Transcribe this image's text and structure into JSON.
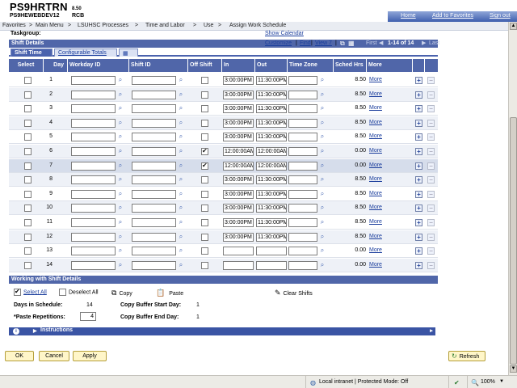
{
  "app": {
    "title": "PS9HRTRN",
    "version": "8.50",
    "database": "PS9HEWEBDEV12",
    "user": "RCB",
    "top_links": [
      "Home",
      "Add to Favorites",
      "Sign out"
    ]
  },
  "nav": {
    "breadcrumb": [
      "Favorites",
      "Main Menu",
      "LSUHSC Processes",
      "Time and Labor",
      "Use",
      "Assign Work Schedule"
    ],
    "separator": ">"
  },
  "taskgroup_label": "Taskgroup:",
  "show_calendar_link": "Show Calendar",
  "shift_details": {
    "title": "Shift Details",
    "tabs": [
      "Shift Time",
      "Configurable Totals"
    ],
    "pager": {
      "customize": "Customize",
      "find": "Find",
      "view": "View 7",
      "first": "First",
      "range": "1-14 of 14",
      "last": "Last"
    },
    "columns": [
      "Select",
      "Day",
      "Workday ID",
      "Shift ID",
      "Off Shift",
      "In",
      "Out",
      "Time Zone",
      "Sched Hrs",
      "More"
    ],
    "more_label": "More",
    "rows": [
      {
        "day": "1",
        "off": false,
        "in": "3:00:00PM",
        "out": "11:30:00PM",
        "hrs": "8.50"
      },
      {
        "day": "2",
        "off": false,
        "in": "3:00:00PM",
        "out": "11:30:00PM",
        "hrs": "8.50"
      },
      {
        "day": "3",
        "off": false,
        "in": "3:00:00PM",
        "out": "11:30:00PM",
        "hrs": "8.50"
      },
      {
        "day": "4",
        "off": false,
        "in": "3:00:00PM",
        "out": "11:30:00PM",
        "hrs": "8.50"
      },
      {
        "day": "5",
        "off": false,
        "in": "3:00:00PM",
        "out": "11:30:00PM",
        "hrs": "8.50"
      },
      {
        "day": "6",
        "off": true,
        "in": "12:00:00AM",
        "out": "12:00:00AM",
        "hrs": "0.00"
      },
      {
        "day": "7",
        "off": true,
        "in": "12:00:00AM",
        "out": "12:00:00AM",
        "hrs": "0.00"
      },
      {
        "day": "8",
        "off": false,
        "in": "3:00:00PM",
        "out": "11:30:00PM",
        "hrs": "8.50"
      },
      {
        "day": "9",
        "off": false,
        "in": "3:00:00PM",
        "out": "11:30:00PM",
        "hrs": "8.50"
      },
      {
        "day": "10",
        "off": false,
        "in": "3:00:00PM",
        "out": "11:30:00PM",
        "hrs": "8.50"
      },
      {
        "day": "11",
        "off": false,
        "in": "3:00:00PM",
        "out": "11:30:00PM",
        "hrs": "8.50"
      },
      {
        "day": "12",
        "off": false,
        "in": "3:00:00PM",
        "out": "11:30:00PM",
        "hrs": "8.50"
      },
      {
        "day": "13",
        "off": false,
        "in": "",
        "out": "",
        "hrs": "0.00"
      },
      {
        "day": "14",
        "off": false,
        "in": "",
        "out": "",
        "hrs": "0.00"
      }
    ]
  },
  "working": {
    "title": "Working with Shift Details",
    "select_all": "Select All",
    "deselect_all": "Deselect All",
    "copy": "Copy",
    "paste": "Paste",
    "clear_shifts": "Clear Shifts",
    "days_label": "Days in Schedule:",
    "days_value": "14",
    "paste_rep_label": "*Paste Repetitions:",
    "paste_rep_value": "4",
    "copy_start_label": "Copy Buffer Start Day:",
    "copy_start_value": "1",
    "copy_end_label": "Copy Buffer End Day:",
    "copy_end_value": "1",
    "instructions": "Instructions"
  },
  "buttons": {
    "ok": "OK",
    "cancel": "Cancel",
    "apply": "Apply",
    "refresh": "Refresh"
  },
  "statusbar": {
    "zone": "Local intranet | Protected Mode: Off",
    "zoom": "100%"
  },
  "colors": {
    "header_blue": "#5066a9",
    "link_blue": "#1a3d9c",
    "button_yellow": "#fff6c9"
  }
}
